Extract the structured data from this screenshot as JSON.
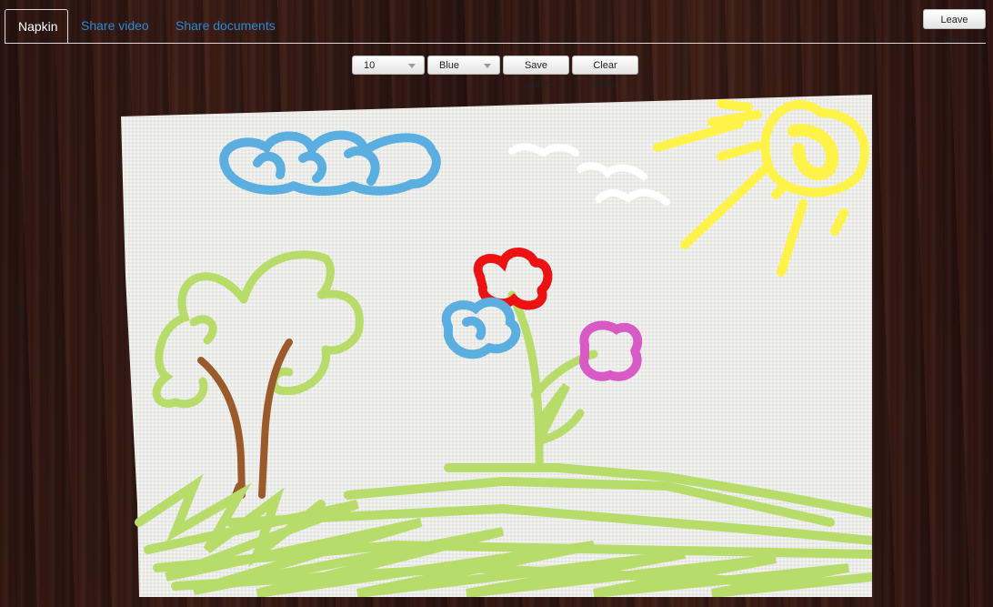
{
  "tabs": [
    {
      "label": "Napkin",
      "active": true
    },
    {
      "label": "Share video",
      "active": false
    },
    {
      "label": "Share documents",
      "active": false
    }
  ],
  "header": {
    "leave_label": "Leave table"
  },
  "toolbar": {
    "size_value": "10",
    "color_value": "Blue",
    "save_label": "Save napkin",
    "clear_label": "Clear napkin"
  },
  "colors": {
    "link": "#2a8ad4",
    "green": "#b8dc6a",
    "brown": "#9b5a2b",
    "blue": "#5aaee0",
    "red": "#ee1111",
    "pink": "#d85ac4",
    "yellow": "#fff34a",
    "white": "#ffffff",
    "napkin": "#ececea"
  }
}
